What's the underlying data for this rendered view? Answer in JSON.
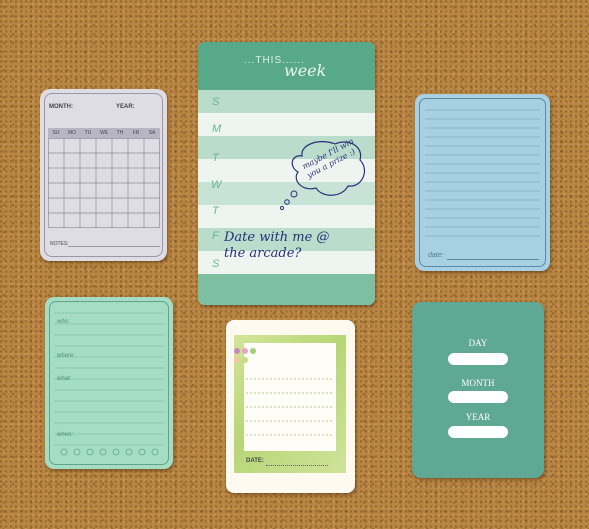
{
  "calendar": {
    "month_label": "MONTH:",
    "year_label": "YEAR:",
    "days": [
      "SU",
      "MO",
      "TU",
      "WE",
      "TH",
      "FR",
      "SA"
    ],
    "notes_label": "NOTES:"
  },
  "week": {
    "title_prefix": "...THIS......",
    "title_word": "week",
    "days": [
      "S",
      "M",
      "T",
      "W",
      "T",
      "F",
      "S"
    ],
    "thought": "maybe I'll win you a prize :)",
    "entry": "Date with me @ the arcade?"
  },
  "blue_card": {
    "date_label": "date:"
  },
  "green_card": {
    "labels": [
      "who:",
      "where:",
      "what:",
      "when:"
    ]
  },
  "photo_card": {
    "date_label": "DATE:"
  },
  "day_card": {
    "labels": [
      "DAY",
      "MONTH",
      "YEAR"
    ]
  }
}
